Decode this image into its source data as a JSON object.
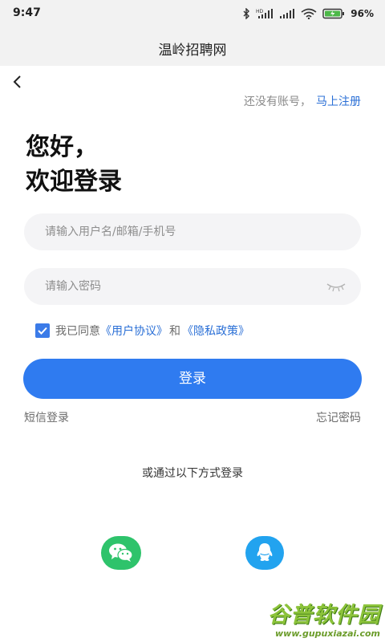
{
  "status_bar": {
    "time": "9:47",
    "battery_percent": "96%",
    "icons": [
      "bluetooth-icon",
      "hd-signal-icon",
      "signal-icon",
      "wifi-icon",
      "battery-icon"
    ]
  },
  "header": {
    "title": "温岭招聘网"
  },
  "top": {
    "back_icon": "back-arrow-icon",
    "no_account": "还没有账号，",
    "register_link": "马上注册"
  },
  "greeting": {
    "line1": "您好，",
    "line2": "欢迎登录"
  },
  "form": {
    "username_placeholder": "请输入用户名/邮箱/手机号",
    "password_placeholder": "请输入密码",
    "agree_checked": true,
    "agree_prefix": "我已同意",
    "user_agreement": "《用户协议》",
    "agree_and": "和",
    "privacy_policy": "《隐私政策》",
    "login_button": "登录",
    "sms_login": "短信登录",
    "forgot_password": "忘记密码"
  },
  "other_login": {
    "label": "或通过以下方式登录",
    "methods": [
      "wechat-icon",
      "qq-icon"
    ]
  },
  "colors": {
    "primary": "#2f7bf0",
    "link": "#2a6fd6",
    "wechat": "#2ec36b",
    "qq": "#22a3ef"
  },
  "watermark": {
    "title": "谷普软件园",
    "url": "www.gupuxiazai.com"
  }
}
